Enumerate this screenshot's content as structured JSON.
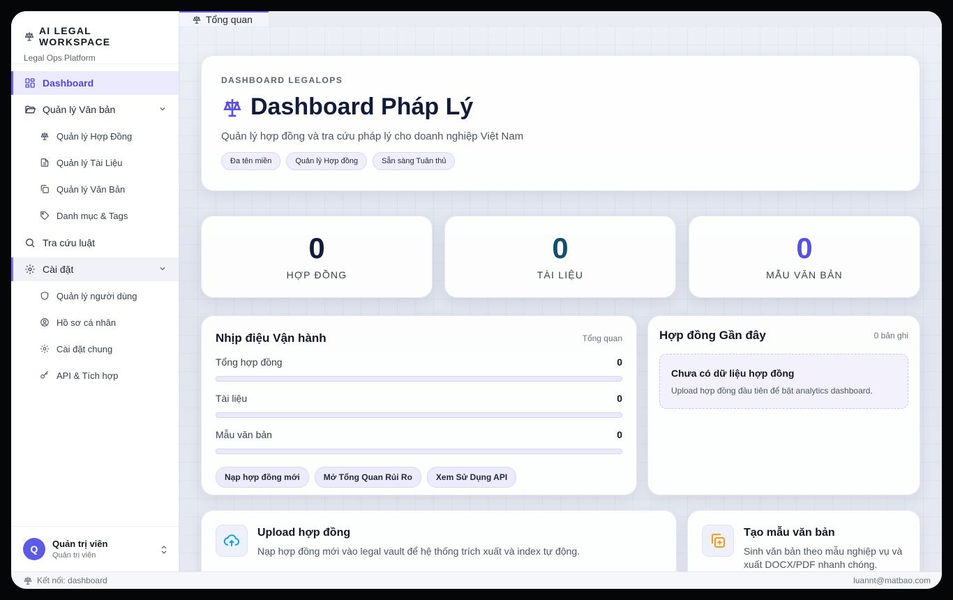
{
  "brand": {
    "title": "AI LEGAL WORKSPACE",
    "subtitle": "Legal Ops Platform"
  },
  "sidebar": {
    "dashboard": "Dashboard",
    "documents_group": "Quản lý Văn bản",
    "documents_items": [
      "Quản lý Hợp Đồng",
      "Quản lý Tài Liệu",
      "Quản lý Văn Bản",
      "Danh mục & Tags"
    ],
    "law_search": "Tra cứu luật",
    "settings_group": "Cài đặt",
    "settings_items": [
      "Quản lý người dùng",
      "Hồ sơ cá nhân",
      "Cài đặt chung",
      "API & Tích hợp"
    ]
  },
  "user": {
    "initial": "Q",
    "name": "Quản trị viên",
    "role": "Quản trị viên"
  },
  "tabs": [
    {
      "label": "Tổng quan"
    }
  ],
  "hero": {
    "eyebrow": "DASHBOARD LEGALOPS",
    "title": "Dashboard Pháp Lý",
    "subtitle": "Quản lý hợp đồng và tra cứu pháp lý cho doanh nghiệp Việt Nam",
    "chips": [
      "Đa tên miền",
      "Quản lý Hợp đồng",
      "Sẵn sàng Tuân thủ"
    ]
  },
  "stats": [
    {
      "value": "0",
      "label": "HỢP ĐỒNG",
      "color": "#111b3a"
    },
    {
      "value": "0",
      "label": "TÀI LIỆU",
      "color": "#134e6f"
    },
    {
      "value": "0",
      "label": "MẪU VĂN BẢN",
      "color": "#5b4fe6"
    }
  ],
  "operations": {
    "title": "Nhịp điệu Vận hành",
    "meta": "Tổng quan",
    "metrics": [
      {
        "label": "Tổng hợp đồng",
        "value": "0",
        "progress": 0
      },
      {
        "label": "Tài liệu",
        "value": "0",
        "progress": 0
      },
      {
        "label": "Mẫu văn bản",
        "value": "0",
        "progress": 0
      }
    ],
    "actions": [
      "Nạp hợp đồng mới",
      "Mở Tổng Quan Rủi Ro",
      "Xem Sử Dụng API"
    ]
  },
  "recent": {
    "title": "Hợp đồng Gần đây",
    "meta": "0 bản ghi",
    "empty_title": "Chưa có dữ liệu hợp đồng",
    "empty_sub": "Upload hợp đồng đầu tiên để bật analytics dashboard."
  },
  "quick_actions": [
    {
      "title": "Upload hợp đồng",
      "sub": "Nạp hợp đồng mới vào legal vault để hệ thống trích xuất và index tự động.",
      "icon": "upload-cloud-icon"
    },
    {
      "title": "Tạo mẫu văn bản",
      "sub": "Sinh văn bản theo mẫu nghiệp vụ và xuất DOCX/PDF nhanh chóng.",
      "icon": "copy-plus-icon"
    }
  ],
  "footer": {
    "status": "Kết nối: dashboard",
    "email": "luannt@matbao.com"
  },
  "colors": {
    "accent": "#6d64f0",
    "accent_text": "#4f46e5"
  }
}
